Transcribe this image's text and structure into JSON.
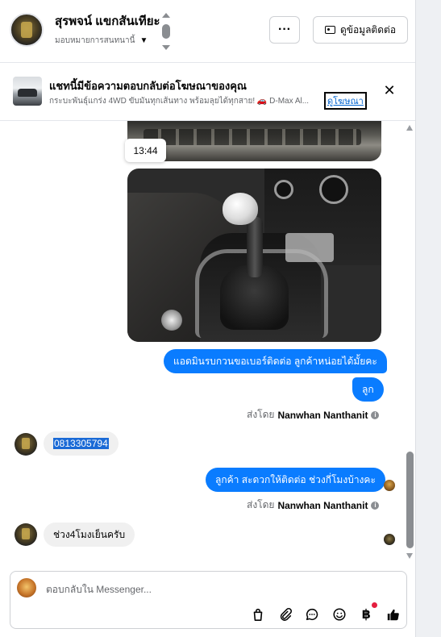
{
  "header": {
    "name": "สุรพจน์ แขกสันเทียะ",
    "assign_label": "มอบหมายการสนทนานี้",
    "more_label": "···",
    "contact_button_label": "ดูข้อมูลติดต่อ"
  },
  "ad_banner": {
    "title": "แชทนี้มีข้อความตอบกลับต่อโฆษณาของคุณ",
    "text": "กระบะพันธุ์แกร่ง 4WD ขับมันทุกเส้นทาง พร้อมลุยได้ทุกสาย! 🚗 D-Max Al...",
    "link_label": "ดูโฆษณา",
    "close_label": "✕"
  },
  "chat": {
    "timestamp_tooltip": "13:44",
    "messages_out_1": "แอดมินรบกวนขอเบอร์ติดต่อ ลูกค้าหน่อยได้มั้ยคะ",
    "messages_out_2": "ลูก",
    "sent_by_prefix": "ส่งโดย",
    "sent_by_name": "Nanwhan Nanthanit",
    "message_in_1": "0813305794",
    "messages_out_3": "ลูกค้า สะดวกให้ติดต่อ ช่วงกี่โมงบ้างคะ",
    "message_in_2": "ช่วง4โมงเย็นครับ"
  },
  "composer": {
    "placeholder": "ตอบกลับใน Messenger...",
    "icons": [
      "bag-icon",
      "attachment-icon",
      "saved-reply-icon",
      "emoji-icon",
      "baht-payment-icon",
      "like-icon"
    ],
    "baht_symbol": "฿"
  },
  "colors": {
    "outgoing_bubble": "#0a7cff",
    "incoming_bubble": "#f0f0f0",
    "link": "#0064d1"
  }
}
